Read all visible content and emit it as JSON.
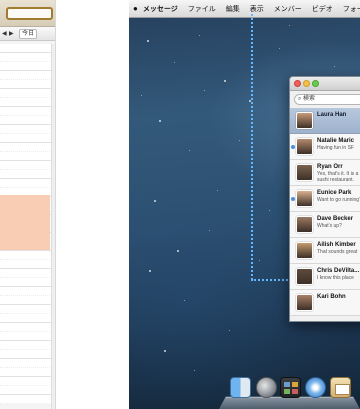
{
  "calendar": {
    "nav_prev": "◀",
    "nav_next": "▶",
    "today_label": "今日",
    "event_color": "#f9cdb4"
  },
  "menubar": {
    "apple_icon": "apple-icon",
    "items": [
      {
        "label": "メッセージ",
        "bold": true
      },
      {
        "label": "ファイル"
      },
      {
        "label": "編集"
      },
      {
        "label": "表示"
      },
      {
        "label": "メンバー"
      },
      {
        "label": "ビデオ"
      },
      {
        "label": "フォーマット"
      }
    ]
  },
  "guides": {
    "color": "#63b6ff"
  },
  "messages_window": {
    "search_placeholder": "検索",
    "conversations": [
      {
        "name": "Laura Han",
        "preview": "",
        "selected": true,
        "unread": false,
        "avatar_color": "#c99a7a"
      },
      {
        "name": "Natalie Maric",
        "preview": "Having fun in SF",
        "selected": false,
        "unread": true,
        "avatar_color": "#b58a6e"
      },
      {
        "name": "Ryan Orr",
        "preview": "Yes, that's it. It is a sushi restaurant.",
        "selected": false,
        "unread": false,
        "avatar_color": "#7a6350"
      },
      {
        "name": "Eunice Park",
        "preview": "Want to go running?",
        "selected": false,
        "unread": true,
        "avatar_color": "#d9b08f"
      },
      {
        "name": "Dave Becker",
        "preview": "What's up?",
        "selected": false,
        "unread": false,
        "avatar_color": "#9a7b63"
      },
      {
        "name": "Ailish Kimber",
        "preview": "That sounds great",
        "selected": false,
        "unread": false,
        "avatar_color": "#c49a6f"
      },
      {
        "name": "Chris DeVilta...",
        "preview": "I know this place",
        "selected": false,
        "unread": false,
        "avatar_color": "#5d4b3e"
      },
      {
        "name": "Kari Bohn",
        "preview": "",
        "selected": false,
        "unread": false,
        "avatar_color": "#a77f66"
      }
    ]
  },
  "dock": {
    "items": [
      "finder-icon",
      "launchpad-icon",
      "mission-control-icon",
      "safari-icon",
      "mail-icon"
    ]
  }
}
